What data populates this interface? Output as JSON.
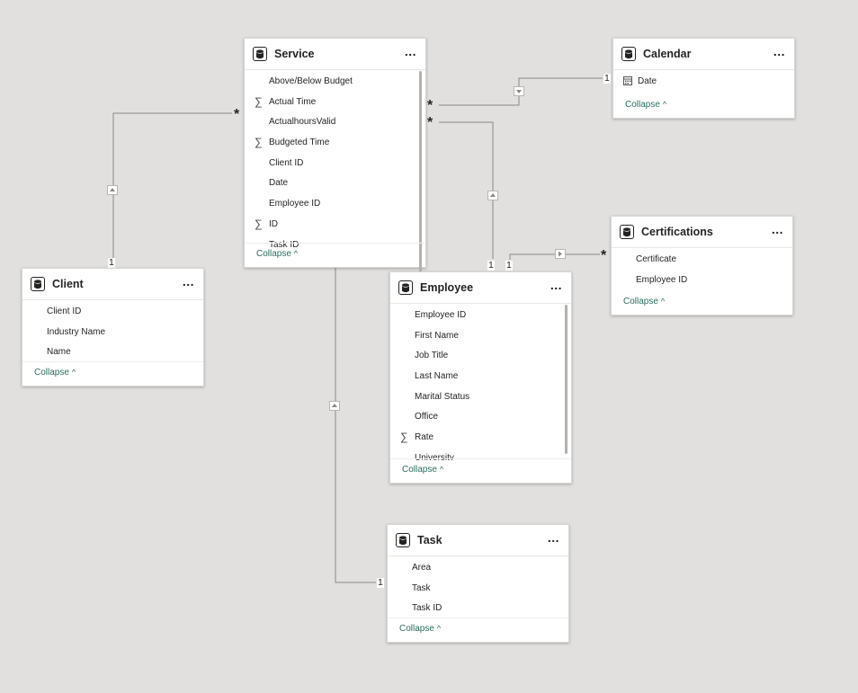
{
  "tables": {
    "service": {
      "title": "Service",
      "fields": [
        {
          "name": "Above/Below Budget",
          "icon": ""
        },
        {
          "name": "Actual Time",
          "icon": "sigma"
        },
        {
          "name": "ActualhoursValid",
          "icon": ""
        },
        {
          "name": "Budgeted Time",
          "icon": "sigma"
        },
        {
          "name": "Client ID",
          "icon": ""
        },
        {
          "name": "Date",
          "icon": ""
        },
        {
          "name": "Employee ID",
          "icon": ""
        },
        {
          "name": "ID",
          "icon": "sigma"
        },
        {
          "name": "Task ID",
          "icon": ""
        }
      ],
      "collapse": "Collapse"
    },
    "calendar": {
      "title": "Calendar",
      "fields": [
        {
          "name": "Date",
          "icon": "calendar"
        }
      ],
      "collapse": "Collapse"
    },
    "certifications": {
      "title": "Certifications",
      "fields": [
        {
          "name": "Certificate",
          "icon": ""
        },
        {
          "name": "Employee ID",
          "icon": ""
        }
      ],
      "collapse": "Collapse"
    },
    "client": {
      "title": "Client",
      "fields": [
        {
          "name": "Client ID",
          "icon": ""
        },
        {
          "name": "Industry Name",
          "icon": ""
        },
        {
          "name": "Name",
          "icon": ""
        }
      ],
      "collapse": "Collapse"
    },
    "employee": {
      "title": "Employee",
      "fields": [
        {
          "name": "Employee ID",
          "icon": ""
        },
        {
          "name": "First Name",
          "icon": ""
        },
        {
          "name": "Job Title",
          "icon": ""
        },
        {
          "name": "Last Name",
          "icon": ""
        },
        {
          "name": "Marital Status",
          "icon": ""
        },
        {
          "name": "Office",
          "icon": ""
        },
        {
          "name": "Rate",
          "icon": "sigma"
        },
        {
          "name": "University",
          "icon": ""
        }
      ],
      "collapse": "Collapse"
    },
    "task": {
      "title": "Task",
      "fields": [
        {
          "name": "Area",
          "icon": ""
        },
        {
          "name": "Task",
          "icon": ""
        },
        {
          "name": "Task ID",
          "icon": ""
        }
      ],
      "collapse": "Collapse"
    }
  },
  "cardinality": {
    "one": "1",
    "many": "*"
  },
  "more_label": "...",
  "colors": {
    "canvas": "#e1e0de",
    "line": "#8a8886",
    "accent": "#2a6f61"
  }
}
